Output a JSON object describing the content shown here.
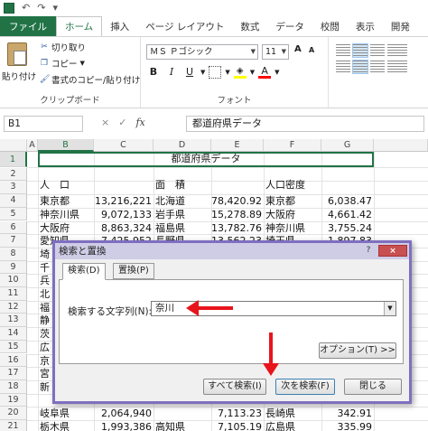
{
  "ribbon": {
    "tabs": [
      {
        "label": "ファイル",
        "key": "file"
      },
      {
        "label": "ホーム",
        "key": "home"
      },
      {
        "label": "挿入",
        "key": "insert"
      },
      {
        "label": "ページ レイアウト",
        "key": "layout"
      },
      {
        "label": "数式",
        "key": "formulas"
      },
      {
        "label": "データ",
        "key": "data"
      },
      {
        "label": "校閲",
        "key": "review"
      },
      {
        "label": "表示",
        "key": "view"
      },
      {
        "label": "開発",
        "key": "developer"
      }
    ],
    "clipboard": {
      "paste_label": "貼り付け",
      "cut_label": "切り取り",
      "copy_label": "コピー",
      "format_painter_label": "書式のコピー/貼り付け",
      "group_label": "クリップボード"
    },
    "font": {
      "font_name": "ＭＳ Ｐゴシック",
      "font_size": "11",
      "grow": "A",
      "shrink": "A",
      "bold": "B",
      "italic": "I",
      "underline": "U",
      "font_color_glyph": "A",
      "group_label": "フォント"
    }
  },
  "formula_bar": {
    "name_box": "B1",
    "cancel": "×",
    "enter": "✓",
    "fx": "fx",
    "content": "都道府県データ"
  },
  "sheet": {
    "columns": [
      "A",
      "B",
      "C",
      "D",
      "E",
      "F",
      "G"
    ],
    "selected_column": "B",
    "rows": [
      "1",
      "2",
      "3",
      "4",
      "5",
      "6",
      "7",
      "8",
      "9",
      "10",
      "11",
      "12",
      "13",
      "14",
      "15",
      "16",
      "17",
      "18",
      "19",
      "20",
      "21"
    ],
    "selected_row": "1",
    "title": "都道府県データ",
    "headers": {
      "population": "人　口",
      "area": "面　積",
      "density": "人口密度"
    },
    "population": [
      {
        "pref": "東京都",
        "value": "13,216,221"
      },
      {
        "pref": "神奈川県",
        "value": "9,072,133"
      },
      {
        "pref": "大阪府",
        "value": "8,863,324"
      },
      {
        "pref": "愛知県",
        "value": "7,425,952"
      },
      {
        "pref": "岐阜県",
        "value": "2,064,940"
      },
      {
        "pref": "栃木県",
        "value": "1,993,386"
      }
    ],
    "area": [
      {
        "pref": "北海道",
        "value": "78,420.92"
      },
      {
        "pref": "岩手県",
        "value": "15,278.89"
      },
      {
        "pref": "福島県",
        "value": "13,782.76"
      },
      {
        "pref": "長野県",
        "value": "13,562.23"
      },
      {
        "pref": "",
        "value": "7,113.23"
      },
      {
        "pref": "高知県",
        "value": "7,105.19"
      }
    ],
    "density": [
      {
        "pref": "東京都",
        "value": "6,038.47"
      },
      {
        "pref": "大阪府",
        "value": "4,661.42"
      },
      {
        "pref": "神奈川県",
        "value": "3,755.24"
      },
      {
        "pref": "埼玉県",
        "value": "1,897.83"
      },
      {
        "pref": "長崎県",
        "value": "342.91"
      },
      {
        "pref": "広島県",
        "value": "335.99"
      }
    ],
    "hidden_col_b_chars": [
      "埼",
      "千",
      "兵",
      "北",
      "福",
      "静",
      "茨",
      "広",
      "京",
      "宮",
      "新"
    ]
  },
  "dialog": {
    "title": "検索と置換",
    "help": "?",
    "close": "×",
    "tab_search": "検索(D)",
    "tab_replace": "置換(P)",
    "search_label": "検索する文字列(N):",
    "search_value": "奈川",
    "dropdown": "▼",
    "options_button": "オプション(T) >>",
    "find_all_button": "すべて検索(I)",
    "find_next_button": "次を検索(F)",
    "close_button": "閉じる"
  },
  "colors": {
    "excel_green": "#217346",
    "dialog_border": "#7f6fbf",
    "annotation_arrow": "#e8141b"
  }
}
